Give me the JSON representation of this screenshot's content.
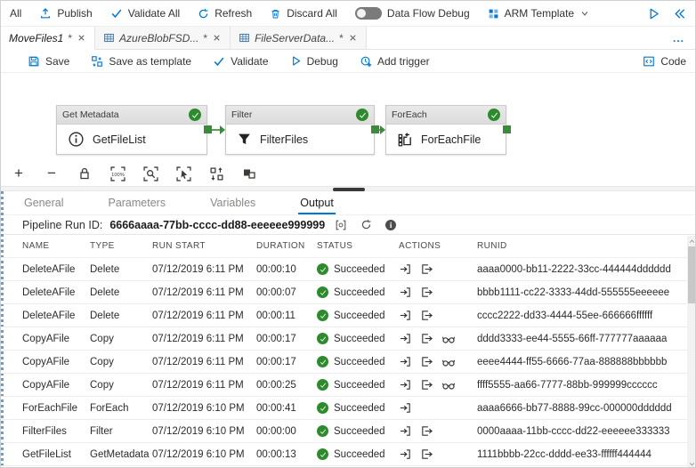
{
  "topbar": {
    "all": "All",
    "publish": "Publish",
    "validate_all": "Validate All",
    "refresh": "Refresh",
    "discard_all": "Discard All",
    "dataflow_debug": "Data Flow Debug",
    "arm_template": "ARM Template"
  },
  "tabbar": {
    "tabs": [
      {
        "label": "MoveFiles1",
        "dirty": "*"
      },
      {
        "label": "AzureBlobFSD...",
        "dirty": "*"
      },
      {
        "label": "FileServerData...",
        "dirty": "*"
      }
    ],
    "more": "..."
  },
  "ptool": {
    "save": "Save",
    "save_as_template": "Save as template",
    "validate": "Validate",
    "debug": "Debug",
    "add_trigger": "Add trigger",
    "code": "Code"
  },
  "canvas": {
    "nodes": [
      {
        "type": "Get Metadata",
        "name": "GetFileList"
      },
      {
        "type": "Filter",
        "name": "FilterFiles"
      },
      {
        "type": "ForEach",
        "name": "ForEachFile"
      }
    ],
    "zoom_level": "100%"
  },
  "panel": {
    "tabs": [
      "General",
      "Parameters",
      "Variables",
      "Output"
    ],
    "run_id_label": "Pipeline Run ID:",
    "run_id": "6666aaaa-77bb-cccc-dd88-eeeeee999999",
    "table": {
      "columns": [
        "NAME",
        "TYPE",
        "RUN START",
        "DURATION",
        "STATUS",
        "ACTIONS",
        "RUNID"
      ],
      "rows": [
        {
          "name": "DeleteAFile",
          "type": "Delete",
          "run_start": "07/12/2019 6:11 PM",
          "duration": "00:00:10",
          "status": "Succeeded",
          "run_id": "aaaa0000-bb11-2222-33cc-444444dddddd"
        },
        {
          "name": "DeleteAFile",
          "type": "Delete",
          "run_start": "07/12/2019 6:11 PM",
          "duration": "00:00:07",
          "status": "Succeeded",
          "run_id": "bbbb1111-cc22-3333-44dd-555555eeeeee"
        },
        {
          "name": "DeleteAFile",
          "type": "Delete",
          "run_start": "07/12/2019 6:11 PM",
          "duration": "00:00:11",
          "status": "Succeeded",
          "run_id": "cccc2222-dd33-4444-55ee-666666ffffff"
        },
        {
          "name": "CopyAFile",
          "type": "Copy",
          "run_start": "07/12/2019 6:11 PM",
          "duration": "00:00:17",
          "status": "Succeeded",
          "run_id": "dddd3333-ee44-5555-66ff-777777aaaaaa"
        },
        {
          "name": "CopyAFile",
          "type": "Copy",
          "run_start": "07/12/2019 6:11 PM",
          "duration": "00:00:17",
          "status": "Succeeded",
          "run_id": "eeee4444-ff55-6666-77aa-888888bbbbbb"
        },
        {
          "name": "CopyAFile",
          "type": "Copy",
          "run_start": "07/12/2019 6:11 PM",
          "duration": "00:00:25",
          "status": "Succeeded",
          "run_id": "ffff5555-aa66-7777-88bb-999999cccccc"
        },
        {
          "name": "ForEachFile",
          "type": "ForEach",
          "run_start": "07/12/2019 6:10 PM",
          "duration": "00:00:41",
          "status": "Succeeded",
          "run_id": "aaaa6666-bb77-8888-99cc-000000dddddd"
        },
        {
          "name": "FilterFiles",
          "type": "Filter",
          "run_start": "07/12/2019 6:10 PM",
          "duration": "00:00:00",
          "status": "Succeeded",
          "run_id": "0000aaaa-11bb-cccc-dd22-eeeeee333333"
        },
        {
          "name": "GetFileList",
          "type": "GetMetadata",
          "run_start": "07/12/2019 6:10 PM",
          "duration": "00:00:13",
          "status": "Succeeded",
          "run_id": "1111bbbb-22cc-dddd-ee33-ffffff444444"
        }
      ]
    }
  },
  "colors": {
    "accent_blue": "#0078d4",
    "success_green": "#2d8a2d",
    "connector_green": "#3c8a3c"
  }
}
